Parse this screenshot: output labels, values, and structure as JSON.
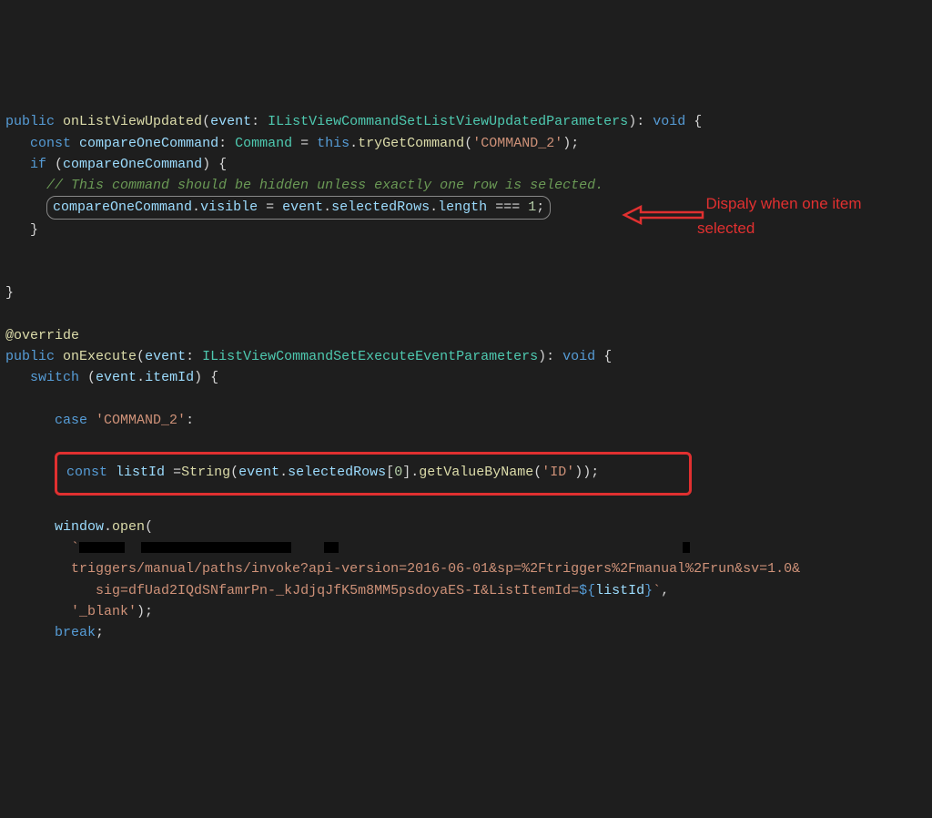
{
  "line1": {
    "kw": "public",
    "fn": "onListViewUpdated",
    "param": "event",
    "type": "IListViewCommandSetListViewUpdatedParameters",
    "ret": "void"
  },
  "line2": {
    "kw": "const",
    "varname": "compareOneCommand",
    "vartype": "Command",
    "this": "this",
    "method": "tryGetCommand",
    "arg": "'COMMAND_2'"
  },
  "line3": {
    "kw": "if",
    "var": "compareOneCommand"
  },
  "line4": {
    "comment": "// This command should be hidden unless exactly one row is selected."
  },
  "line5": {
    "obj": "compareOneCommand",
    "prop": "visible",
    "evt": "event",
    "sel": "selectedRows",
    "len": "length",
    "num": "1"
  },
  "annotation1": {
    "l1": "Dispaly when one item",
    "l2": "selected"
  },
  "override": "@override",
  "line8": {
    "kw": "public",
    "fn": "onExecute",
    "param": "event",
    "type": "IListViewCommandSetExecuteEventParameters",
    "ret": "void"
  },
  "line9": {
    "kw": "switch",
    "evt": "event",
    "prop": "itemId"
  },
  "line11": {
    "kw": "case",
    "str": "'COMMAND_2'"
  },
  "line13": {
    "kw": "const",
    "varname": "listId",
    "fn": "String",
    "evt": "event",
    "sel": "selectedRows",
    "idx": "0",
    "method": "getValueByName",
    "arg": "'ID'"
  },
  "line15": {
    "obj": "window",
    "method": "open"
  },
  "line17": {
    "str": "triggers/manual/paths/invoke?api-version=2016-06-01&sp=%2Ftriggers%2Fmanual%2Frun&sv=1.0&"
  },
  "line18": {
    "str1": "sig=dfUad2IQdSNfamrPn-_kJdjqJfK5m8MM5psdoyaES-I&ListItemId=",
    "interp_open": "${",
    "varname": "listId",
    "interp_close": "}",
    "tick": "`"
  },
  "line19": {
    "str": "'_blank'"
  },
  "line20": {
    "kw": "break"
  }
}
